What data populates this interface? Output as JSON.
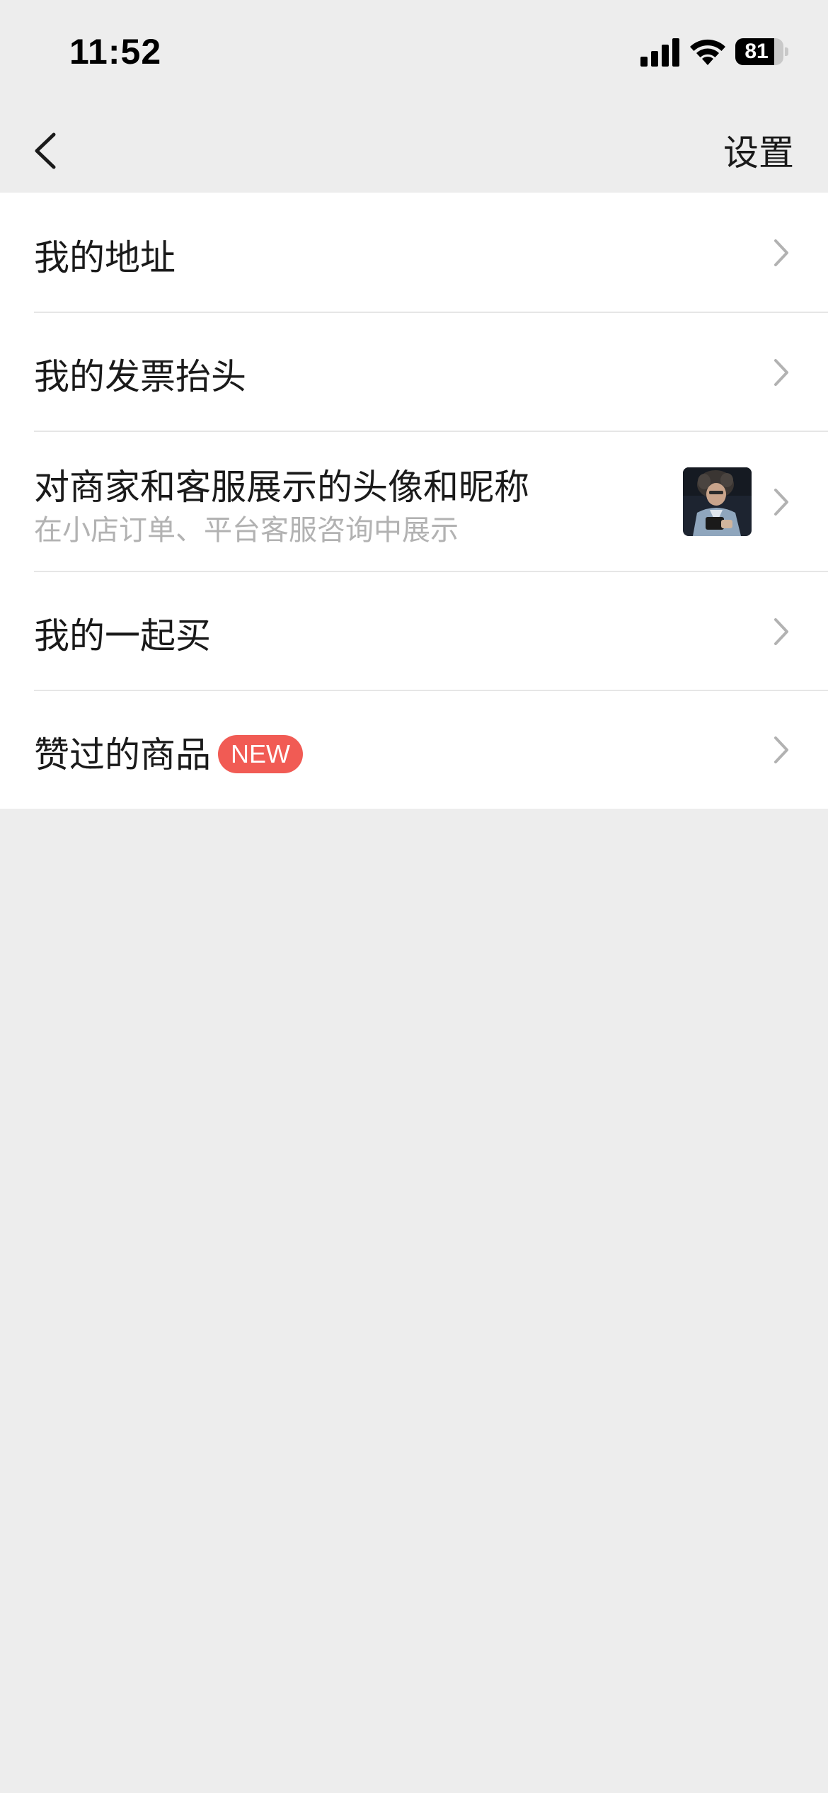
{
  "status_bar": {
    "time": "11:52",
    "battery_level": "81",
    "battery_fraction": 0.81,
    "icons": [
      "cellular-signal-icon",
      "wifi-icon",
      "battery-icon"
    ]
  },
  "nav": {
    "back_icon": "chevron-left-icon",
    "title": "设置"
  },
  "menu": {
    "items": [
      {
        "label": "我的地址"
      },
      {
        "label": "我的发票抬头"
      },
      {
        "label": "对商家和客服展示的头像和昵称",
        "sublabel": "在小店订单、平台客服咨询中展示",
        "has_avatar": true
      },
      {
        "label": "我的一起买"
      },
      {
        "label": "赞过的商品",
        "badge": "NEW"
      }
    ]
  },
  "colors": {
    "background": "#ededed",
    "card": "#ffffff",
    "badge": "#f15b54",
    "sublabel": "#b2b2b2",
    "chevron": "#b2b2b2"
  }
}
